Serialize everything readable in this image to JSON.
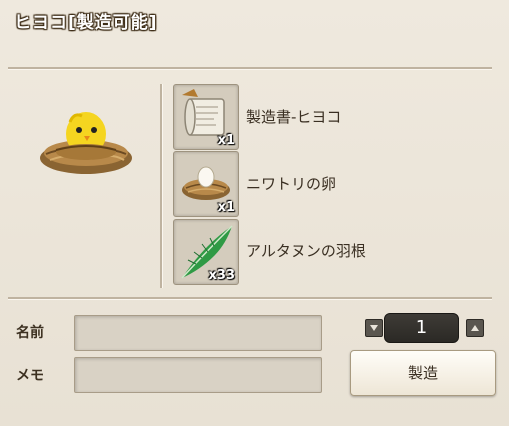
{
  "window": {
    "title": "ヒヨコ[製造可能]"
  },
  "product": {
    "icon": "chick-in-nest-icon"
  },
  "materials": [
    {
      "name": "製造書-ヒヨコ",
      "qty": "x1",
      "icon": "scroll-icon"
    },
    {
      "name": "ニワトリの卵",
      "qty": "x1",
      "icon": "egg-in-nest-icon"
    },
    {
      "name": "アルタヌンの羽根",
      "qty": "x33",
      "icon": "green-feather-icon"
    }
  ],
  "form": {
    "name_label": "名前",
    "name_value": "",
    "memo_label": "メモ",
    "memo_value": ""
  },
  "quantity": {
    "value": "1"
  },
  "actions": {
    "make_label": "製造"
  }
}
